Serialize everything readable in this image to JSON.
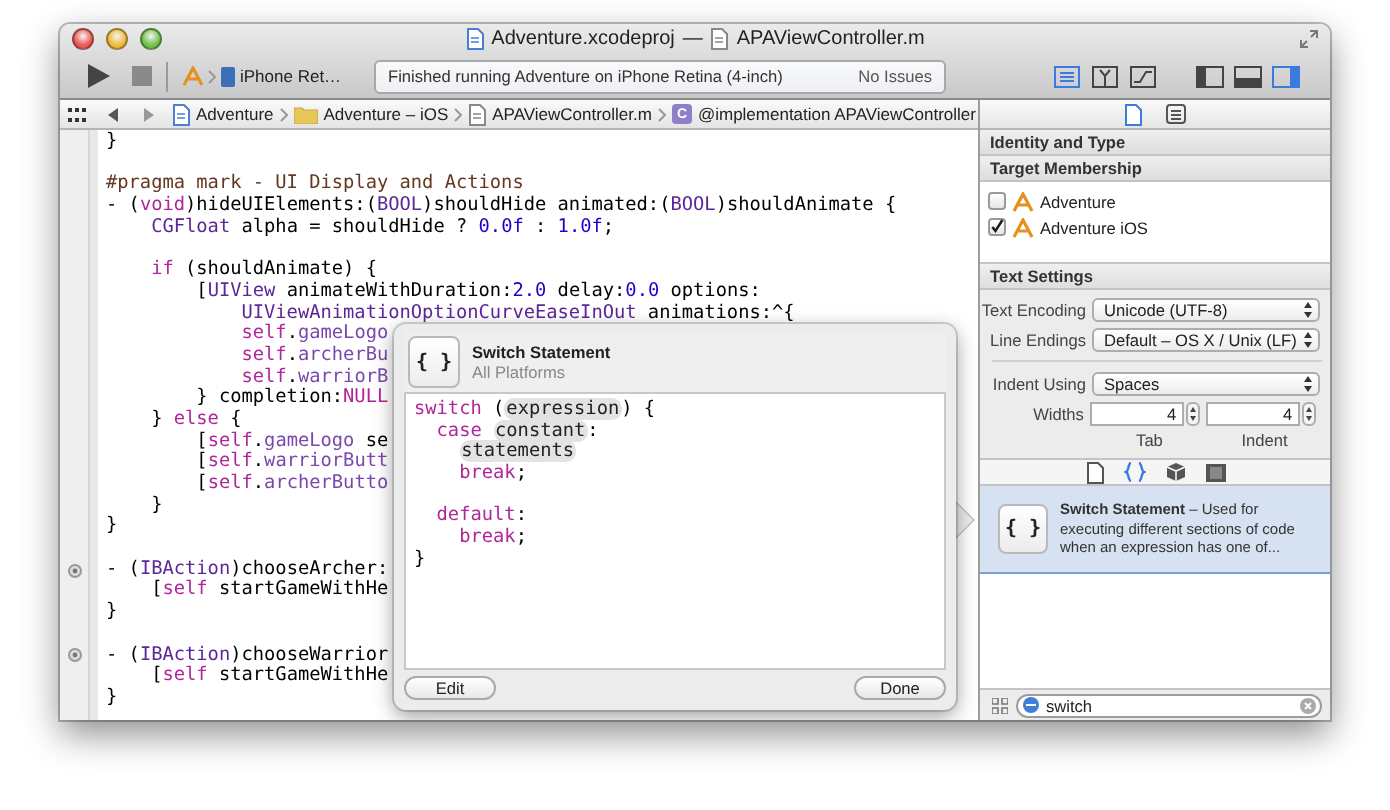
{
  "window": {
    "title": {
      "project": "Adventure.xcodeproj",
      "separator": "—",
      "file": "APAViewController.m"
    }
  },
  "toolbar": {
    "scheme": {
      "device": "iPhone Ret…"
    },
    "activity": {
      "message": "Finished running Adventure on iPhone Retina (4-inch)",
      "issues": "No Issues"
    },
    "editor_modes": [
      {
        "kind": "standard",
        "selected": true
      },
      {
        "kind": "assistant",
        "selected": false
      },
      {
        "kind": "version",
        "selected": false
      }
    ],
    "views": [
      {
        "kind": "navigator",
        "selected": false
      },
      {
        "kind": "debug",
        "selected": false
      },
      {
        "kind": "utilities",
        "selected": true
      }
    ]
  },
  "editor": {
    "jump_bar": [
      {
        "kind": "project",
        "label": "Adventure"
      },
      {
        "kind": "folder",
        "label": "Adventure – iOS"
      },
      {
        "kind": "file",
        "label": "APAViewController.m"
      },
      {
        "kind": "class",
        "badge": "C",
        "label": "@implementation APAViewController"
      }
    ],
    "lines": [
      {
        "outlet": false,
        "tokens": [
          {
            "text": "}",
            "kind": "plain"
          }
        ]
      },
      {
        "outlet": false
      },
      {
        "outlet": false,
        "tokens": [
          {
            "text": "#pragma mark - UI Display and Actions",
            "kind": "macro"
          }
        ]
      },
      {
        "outlet": false,
        "tokens": [
          {
            "text": "- (",
            "kind": "plain"
          },
          {
            "text": "void",
            "kind": "keyword"
          },
          {
            "text": ")hideUIElements:(",
            "kind": "plain"
          },
          {
            "text": "BOOL",
            "kind": "type"
          },
          {
            "text": ")shouldHide animated:(",
            "kind": "plain"
          },
          {
            "text": "BOOL",
            "kind": "type"
          },
          {
            "text": ")shouldAnimate {",
            "kind": "plain"
          }
        ]
      },
      {
        "outlet": false,
        "tokens": [
          {
            "text": "    CGFloat",
            "kind": "type"
          },
          {
            "text": " alpha = shouldHide ? ",
            "kind": "plain"
          },
          {
            "text": "0.0f",
            "kind": "number"
          },
          {
            "text": " : ",
            "kind": "plain"
          },
          {
            "text": "1.0f",
            "kind": "number"
          },
          {
            "text": ";",
            "kind": "plain"
          }
        ]
      },
      {
        "outlet": false
      },
      {
        "outlet": false,
        "tokens": [
          {
            "text": "    if",
            "kind": "keyword"
          },
          {
            "text": " (shouldAnimate) {",
            "kind": "plain"
          }
        ]
      },
      {
        "outlet": false,
        "tokens": [
          {
            "text": "        [",
            "kind": "plain"
          },
          {
            "text": "UIView",
            "kind": "type"
          },
          {
            "text": " animateWithDuration:",
            "kind": "plain"
          },
          {
            "text": "2.0",
            "kind": "number"
          },
          {
            "text": " delay:",
            "kind": "plain"
          },
          {
            "text": "0.0",
            "kind": "number"
          },
          {
            "text": " options:",
            "kind": "plain"
          }
        ]
      },
      {
        "outlet": false,
        "tokens": [
          {
            "text": "            UIViewAnimationOptionCurveEaseInOut",
            "kind": "type"
          },
          {
            "text": " animations:^{",
            "kind": "plain"
          }
        ]
      },
      {
        "outlet": false,
        "tokens": [
          {
            "text": "            self",
            "kind": "keyword"
          },
          {
            "text": ".",
            "kind": "plain"
          },
          {
            "text": "gameLogo",
            "kind": "ident"
          }
        ]
      },
      {
        "outlet": false,
        "tokens": [
          {
            "text": "            self",
            "kind": "keyword"
          },
          {
            "text": ".",
            "kind": "plain"
          },
          {
            "text": "archerBu",
            "kind": "ident"
          }
        ]
      },
      {
        "outlet": false,
        "tokens": [
          {
            "text": "            self",
            "kind": "keyword"
          },
          {
            "text": ".",
            "kind": "plain"
          },
          {
            "text": "warriorB",
            "kind": "ident"
          }
        ]
      },
      {
        "outlet": false,
        "tokens": [
          {
            "text": "        } completion:",
            "kind": "plain"
          },
          {
            "text": "NULL",
            "kind": "keyword"
          }
        ]
      },
      {
        "outlet": false,
        "tokens": [
          {
            "text": "    } ",
            "kind": "plain"
          },
          {
            "text": "else",
            "kind": "keyword"
          },
          {
            "text": " {",
            "kind": "plain"
          }
        ]
      },
      {
        "outlet": false,
        "tokens": [
          {
            "text": "        [",
            "kind": "plain"
          },
          {
            "text": "self",
            "kind": "keyword"
          },
          {
            "text": ".",
            "kind": "plain"
          },
          {
            "text": "gameLogo",
            "kind": "ident"
          },
          {
            "text": " se",
            "kind": "plain"
          }
        ]
      },
      {
        "outlet": false,
        "tokens": [
          {
            "text": "        [",
            "kind": "plain"
          },
          {
            "text": "self",
            "kind": "keyword"
          },
          {
            "text": ".",
            "kind": "plain"
          },
          {
            "text": "warriorButt",
            "kind": "ident"
          }
        ]
      },
      {
        "outlet": false,
        "tokens": [
          {
            "text": "        [",
            "kind": "plain"
          },
          {
            "text": "self",
            "kind": "keyword"
          },
          {
            "text": ".",
            "kind": "plain"
          },
          {
            "text": "archerButto",
            "kind": "ident"
          }
        ]
      },
      {
        "outlet": false,
        "tokens": [
          {
            "text": "    }",
            "kind": "plain"
          }
        ]
      },
      {
        "outlet": false,
        "tokens": [
          {
            "text": "}",
            "kind": "plain"
          }
        ]
      },
      {
        "outlet": false
      },
      {
        "outlet": true,
        "tokens": [
          {
            "text": "- (",
            "kind": "plain"
          },
          {
            "text": "IBAction",
            "kind": "type"
          },
          {
            "text": ")chooseArcher:",
            "kind": "plain"
          }
        ]
      },
      {
        "outlet": false,
        "tokens": [
          {
            "text": "    [",
            "kind": "plain"
          },
          {
            "text": "self",
            "kind": "keyword"
          },
          {
            "text": " startGameWithHe",
            "kind": "plain"
          }
        ]
      },
      {
        "outlet": false,
        "tokens": [
          {
            "text": "}",
            "kind": "plain"
          }
        ]
      },
      {
        "outlet": false
      },
      {
        "outlet": true,
        "tokens": [
          {
            "text": "- (",
            "kind": "plain"
          },
          {
            "text": "IBAction",
            "kind": "type"
          },
          {
            "text": ")chooseWarrior",
            "kind": "plain"
          }
        ]
      },
      {
        "outlet": false,
        "tokens": [
          {
            "text": "    [",
            "kind": "plain"
          },
          {
            "text": "self",
            "kind": "keyword"
          },
          {
            "text": " startGameWithHe",
            "kind": "plain"
          }
        ]
      },
      {
        "outlet": false,
        "tokens": [
          {
            "text": "}",
            "kind": "plain"
          }
        ]
      }
    ],
    "snippet_popover": {
      "icon": "{ }",
      "title": "Switch Statement",
      "subtitle": "All Platforms",
      "lines": [
        {
          "gap_before": false,
          "tokens": [
            {
              "text": "switch",
              "kind": "keyword"
            },
            {
              "text": " (",
              "kind": "plain"
            },
            {
              "text": "expression",
              "kind": "placeholder"
            },
            {
              "text": ") {",
              "kind": "plain"
            }
          ]
        },
        {
          "gap_before": false,
          "tokens": [
            {
              "text": "  case ",
              "kind": "keyword"
            },
            {
              "text": "constant",
              "kind": "placeholder"
            },
            {
              "text": ":",
              "kind": "plain"
            }
          ]
        },
        {
          "gap_before": false,
          "tokens": [
            {
              "text": "    statements",
              "kind": "placeholder"
            }
          ]
        },
        {
          "gap_before": false,
          "tokens": [
            {
              "text": "    break",
              "kind": "keyword"
            },
            {
              "text": ";",
              "kind": "plain"
            }
          ]
        },
        {
          "gap_before": true,
          "tokens": [
            {
              "text": "  default",
              "kind": "keyword"
            },
            {
              "text": ":",
              "kind": "plain"
            }
          ]
        },
        {
          "gap_before": false,
          "tokens": [
            {
              "text": "    break",
              "kind": "keyword"
            },
            {
              "text": ";",
              "kind": "plain"
            }
          ]
        },
        {
          "gap_before": false,
          "tokens": [
            {
              "text": "}",
              "kind": "plain"
            }
          ]
        }
      ],
      "buttons": [
        "Edit",
        "Done"
      ]
    }
  },
  "inspector": {
    "tabs": [
      {
        "kind": "file",
        "selected": true
      },
      {
        "kind": "quick_help",
        "selected": false
      }
    ],
    "identity_header": "Identity and Type",
    "target_membership": {
      "title": "Target Membership",
      "targets": [
        {
          "name": "Adventure",
          "checked": false
        },
        {
          "name": "Adventure iOS",
          "checked": true
        }
      ]
    },
    "text_settings": {
      "title": "Text Settings",
      "popups": [
        {
          "label": "Text Encoding",
          "value": "Unicode (UTF-8)"
        },
        {
          "label": "Line Endings",
          "value": "Default – OS X / Unix (LF)"
        }
      ],
      "indent_using": {
        "label": "Indent Using",
        "value": "Spaces"
      },
      "widths": {
        "label": "Widths",
        "fields": [
          {
            "value": "4",
            "caption": "Tab"
          },
          {
            "value": "4",
            "caption": "Indent"
          }
        ]
      }
    }
  },
  "library": {
    "tabs": [
      {
        "kind": "file",
        "selected": false
      },
      {
        "kind": "code",
        "selected": true
      },
      {
        "kind": "object",
        "selected": false
      },
      {
        "kind": "media",
        "selected": false
      }
    ],
    "items": [
      {
        "icon": "{ }",
        "text": "**Switch Statement** – Used for executing different sections of code when an expression has one of...",
        "selected": true
      }
    ],
    "filter": {
      "value": "switch"
    }
  }
}
